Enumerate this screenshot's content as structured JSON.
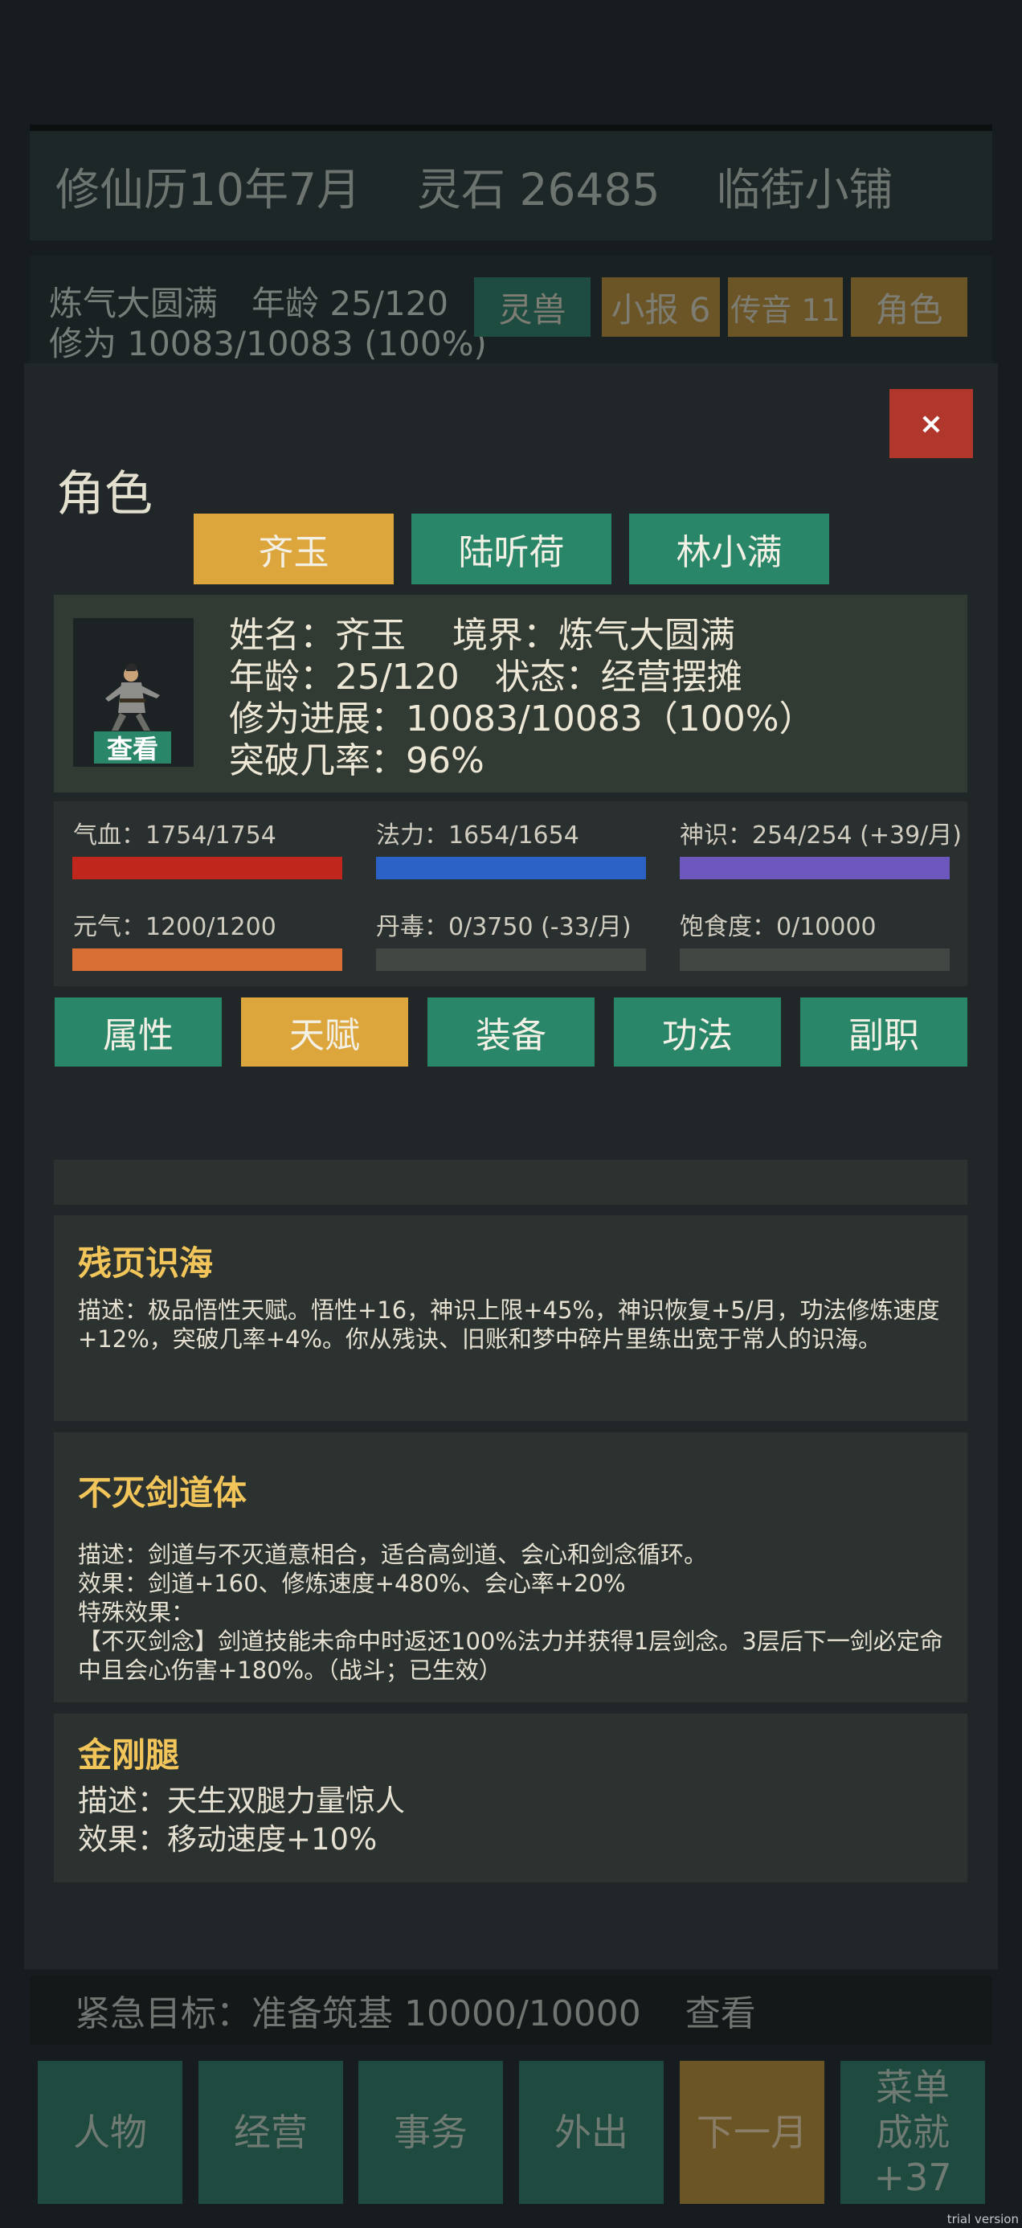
{
  "header": {
    "date": "修仙历10年7月",
    "spirit_stones": "灵石 26485",
    "shop": "临街小铺"
  },
  "status_lines": {
    "line1": "炼气大圆满　年龄 25/120",
    "line2": "修为 10083/10083 (100%)"
  },
  "top_buttons": {
    "beast": "灵兽",
    "news": "小报 6",
    "message": "传音 11",
    "role": "角色"
  },
  "modal": {
    "title": "角色",
    "close": "×",
    "characters": [
      "齐玉",
      "陆听荷",
      "林小满"
    ],
    "info": {
      "line1": "姓名：齐玉　 境界：炼气大圆满",
      "line2": "年龄：25/120　状态：经营摆摊",
      "line3": "修为进展：10083/10083（100%）",
      "line4": "突破几率：96%",
      "view": "查看"
    },
    "stats": {
      "hp": "气血：1754/1754",
      "mana": "法力：1654/1654",
      "spirit": "神识：254/254 (+39/月)",
      "vitality": "元气：1200/1200",
      "poison": "丹毒：0/3750 (-33/月)",
      "satiety": "饱食度：0/10000",
      "hp_fill": 1.0,
      "mana_fill": 1.0,
      "spirit_fill": 1.0,
      "vitality_fill": 1.0,
      "poison_fill": 0.0,
      "satiety_fill": 0.0,
      "colors": {
        "hp": "#c1261d",
        "mana": "#2c62c6",
        "spirit": "#6d58be",
        "vitality": "#d86f35"
      }
    },
    "tabs": [
      "属性",
      "天赋",
      "装备",
      "功法",
      "副职"
    ],
    "active_tab": "天赋",
    "talents": [
      {
        "name": "残页识海",
        "desc": "描述：极品悟性天赋。悟性+16，神识上限+45%，神识恢复+5/月，功法修炼速度+12%，突破几率+4%。你从残诀、旧账和梦中碎片里练出宽于常人的识海。"
      },
      {
        "name": "不灭剑道体",
        "desc": "描述：剑道与不灭道意相合，适合高剑道、会心和剑念循环。",
        "effect": "效果：剑道+160、修炼速度+480%、会心率+20%",
        "special_label": "特殊效果：",
        "special": "【不灭剑念】剑道技能未命中时返还100%法力并获得1层剑念。3层后下一剑必定命中且会心伤害+180%。（战斗；已生效）"
      },
      {
        "name": "金刚腿",
        "desc": "描述：天生双腿力量惊人",
        "effect": "效果：移动速度+10%"
      }
    ]
  },
  "goal": {
    "text": "紧急目标：准备筑基 10000/10000",
    "view": "查看"
  },
  "nav": {
    "person": "人物",
    "business": "经营",
    "affairs": "事务",
    "outing": "外出",
    "next_month": "下一月",
    "menu": "菜单",
    "achievement": "成就+37"
  },
  "watermark": "trial version"
}
